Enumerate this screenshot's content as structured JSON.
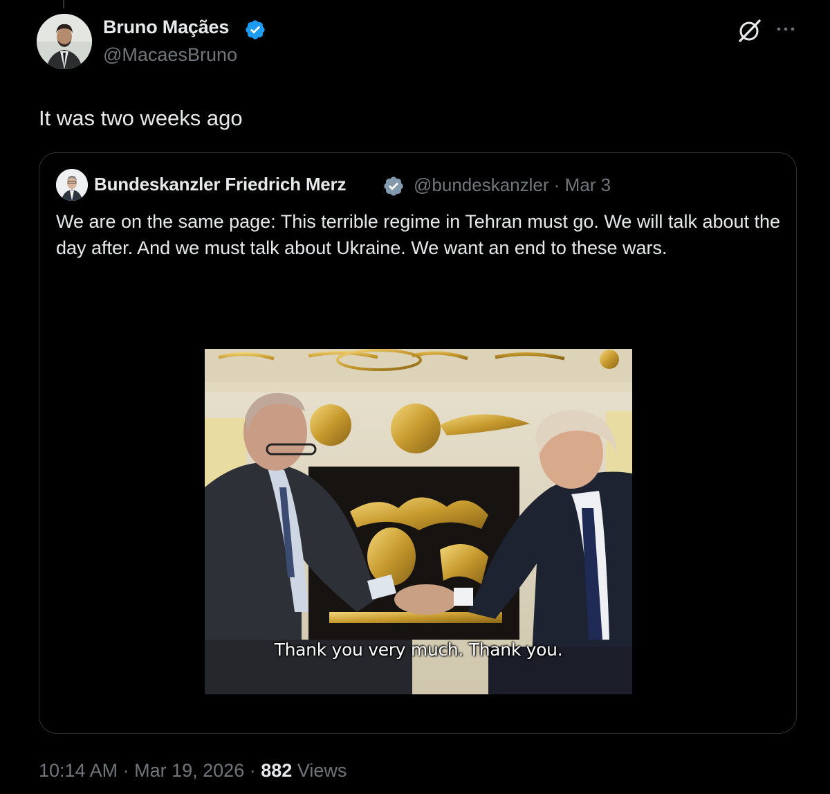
{
  "author": {
    "name": "Bruno Maçães",
    "handle": "@MacaesBruno",
    "verified": true
  },
  "tweet": {
    "text": "It was two weeks ago"
  },
  "quote": {
    "author_name": "Bundeskanzler Friedrich Merz",
    "author_handle": "@bundeskanzler",
    "separator": "·",
    "date": "Mar 3",
    "text": "We are on the same page: This terrible regime in Tehran must go. We will talk about the day after. And we must talk about Ukraine. We want an end to these wars.",
    "media": {
      "caption": "Thank you very much. Thank you."
    }
  },
  "footer": {
    "time": "10:14 AM",
    "sep1": "·",
    "date": "Mar 19, 2026",
    "sep2": "·",
    "views_count": "882",
    "views_label": "Views"
  },
  "icons": {
    "verified": "verified-badge-icon",
    "grok": "grok-icon",
    "more": "more-options-icon"
  },
  "colors": {
    "background": "#000000",
    "text_primary": "#e7e9ea",
    "text_secondary": "#71767b",
    "verified_blue": "#1d9bf0",
    "border": "#2f3336"
  }
}
